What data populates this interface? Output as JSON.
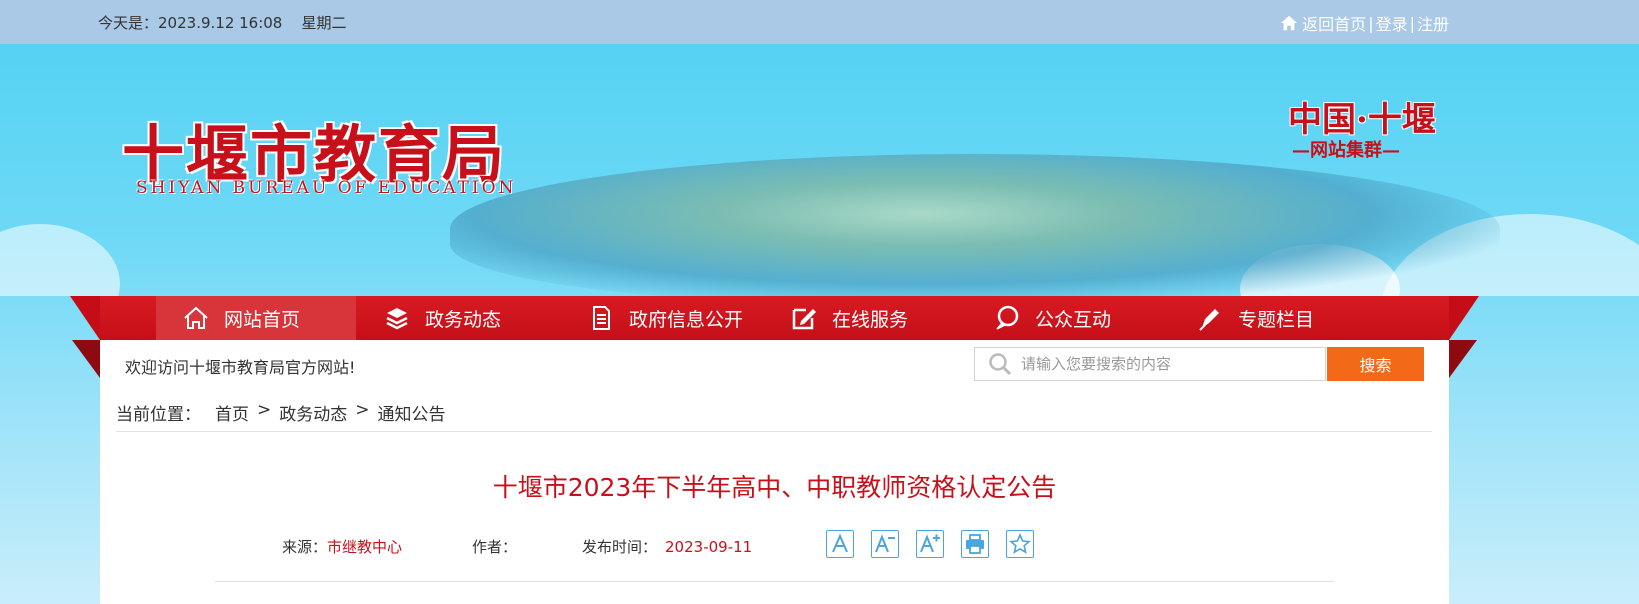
{
  "topbar": {
    "date_label": "今天是：",
    "date_value": "2023.9.12 16:08",
    "weekday": "星期二",
    "home_link": "返回首页",
    "login_link": "登录",
    "register_link": "注册",
    "separator": "|"
  },
  "banner": {
    "site_title_cn": "十堰市教育局",
    "site_title_en": "SHIYAN BUREAU OF EDUCATION",
    "cluster_title": "中国·十堰",
    "cluster_subtitle": "网站集群"
  },
  "nav": {
    "items": [
      {
        "label": "网站首页",
        "icon": "home-icon",
        "active": true
      },
      {
        "label": "政务动态",
        "icon": "layers-icon",
        "active": false
      },
      {
        "label": "政府信息公开",
        "icon": "document-icon",
        "active": false
      },
      {
        "label": "在线服务",
        "icon": "edit-icon",
        "active": false
      },
      {
        "label": "公众互动",
        "icon": "chat-icon",
        "active": false
      },
      {
        "label": "专题栏目",
        "icon": "pen-icon",
        "active": false
      }
    ]
  },
  "welcome": "欢迎访问十堰市教育局官方网站!",
  "search": {
    "placeholder": "请输入您要搜索的内容",
    "button_label": "搜索"
  },
  "breadcrumb": {
    "label": "当前位置：",
    "items": [
      "首页",
      "政务动态",
      "通知公告"
    ],
    "separator": ">"
  },
  "article": {
    "title": "十堰市2023年下半年高中、中职教师资格认定公告",
    "source_label": "来源：",
    "source_value": "市继教中心",
    "author_label": "作者：",
    "author_value": "",
    "date_label": "发布时间：",
    "date_value": "2023-09-11"
  },
  "colors": {
    "brand_red": "#c8101b",
    "nav_red": "#c50f18",
    "search_orange": "#f26a18",
    "tool_blue": "#4aa5e0"
  }
}
